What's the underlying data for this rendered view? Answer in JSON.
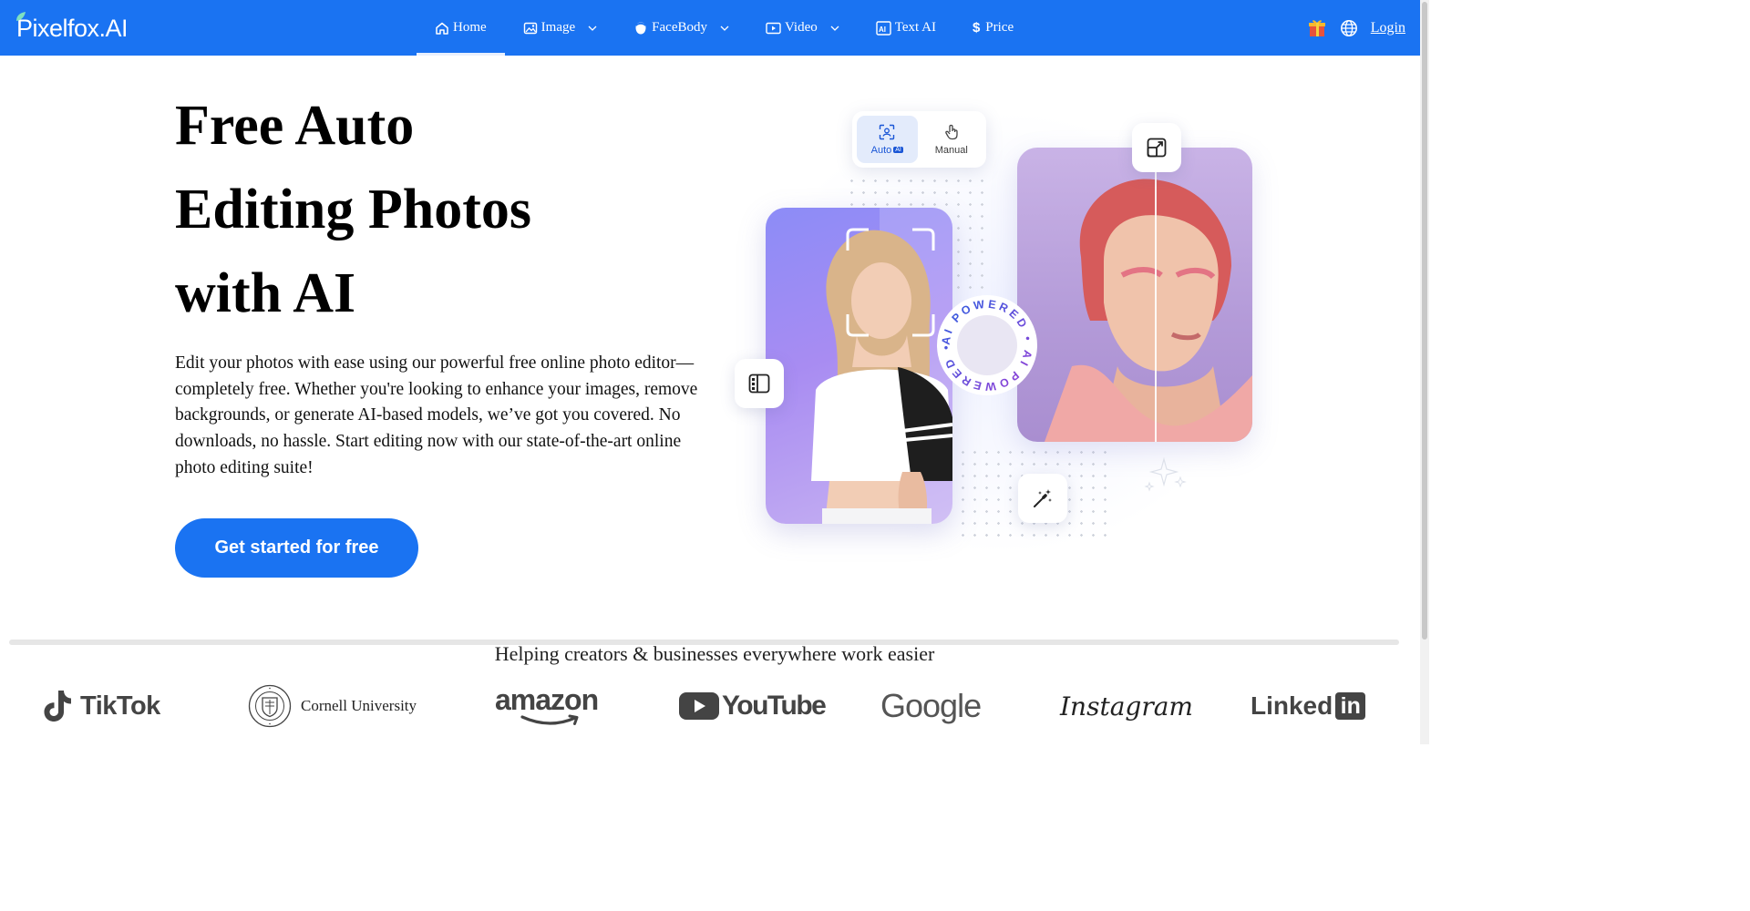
{
  "nav": {
    "brand": "Pixelfox.AI",
    "items": [
      {
        "label": "Home",
        "icon": "home-icon"
      },
      {
        "label": "Image",
        "icon": "image-icon"
      },
      {
        "label": "FaceBody",
        "icon": "face-icon"
      },
      {
        "label": "Video",
        "icon": "video-icon"
      },
      {
        "label": "Text AI",
        "icon": "text-ai-icon"
      },
      {
        "label": "Price",
        "icon": "dollar-icon"
      }
    ],
    "login": "Login",
    "accent_color": "#1a73f2"
  },
  "hero": {
    "title_line1": "Free Auto",
    "title_line2": "Editing Photos",
    "title_line3": "with AI",
    "description": "Edit your photos with ease using our powerful free online photo editor—completely free. Whether you're looking to enhance your images, remove backgrounds, or generate AI-based models, we’ve got you covered. No downloads, no hassle. Start editing now with our state-of-the-art online photo editing suite!",
    "cta": "Get started for free"
  },
  "illustration": {
    "mode_auto": "Auto",
    "mode_auto_chip": "AI",
    "mode_manual": "Manual",
    "badge_text": "AI POWERED • AI POWERED •"
  },
  "partners": {
    "heading": "Helping creators & businesses everywhere work easier",
    "tiktok": "TikTok",
    "cornell": "Cornell University",
    "amazon": "amazon",
    "youtube": "YouTube",
    "google": "Google",
    "instagram": "Instagram",
    "linkedin": "Linked",
    "linkedin_box": "in"
  }
}
